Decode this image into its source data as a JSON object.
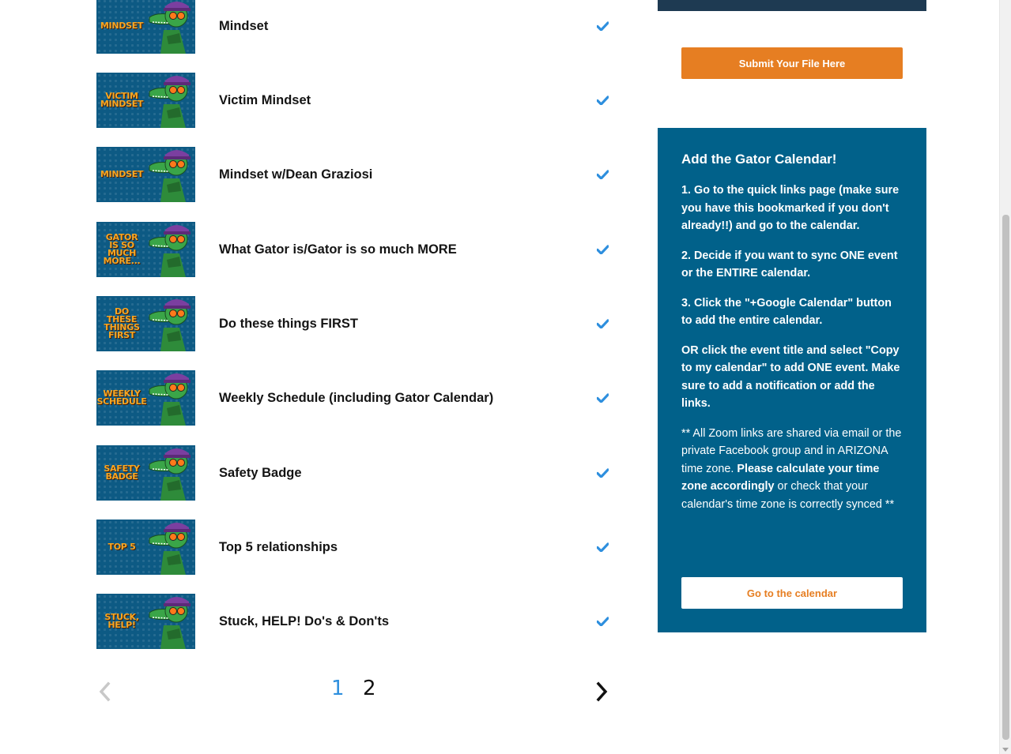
{
  "lessons": [
    {
      "title": "Mindset",
      "thumb_text": "MINDSET",
      "completed": true
    },
    {
      "title": "Victim Mindset",
      "thumb_text": "VICTIM MINDSET",
      "completed": true
    },
    {
      "title": "Mindset w/Dean Graziosi",
      "thumb_text": "MINDSET",
      "completed": true
    },
    {
      "title": "What Gator is/Gator is so much MORE",
      "thumb_text": "GATOR IS SO MUCH MORE...",
      "completed": true
    },
    {
      "title": "Do these things FIRST",
      "thumb_text": "DO THESE THINGS FIRST",
      "completed": true
    },
    {
      "title": "Weekly Schedule (including Gator Calendar)",
      "thumb_text": "WEEKLY SCHEDULE",
      "completed": true
    },
    {
      "title": "Safety Badge",
      "thumb_text": "SAFETY BADGE",
      "completed": true
    },
    {
      "title": "Top 5 relationships",
      "thumb_text": "TOP 5",
      "completed": true
    },
    {
      "title": "Stuck, HELP! Do's & Don'ts",
      "thumb_text": "STUCK, HELP!",
      "completed": true
    }
  ],
  "pagination": {
    "pages": [
      "1",
      "2"
    ],
    "current": "1"
  },
  "sidebar": {
    "submit_button": "Submit Your File Here",
    "calendar": {
      "title": "Add the Gator Calendar!",
      "step1": "1. Go to the quick links page (make sure you have this bookmarked if you don't already!!) and go to the calendar.",
      "step2": "2. Decide if you want to sync ONE event or the ENTIRE calendar.",
      "step3": "3. Click the \"+Google Calendar\" button to add the entire calendar.",
      "step4": "OR click the event title and select \"Copy to my calendar\" to add ONE event. Make sure to add a notification or add the links.",
      "note_part1": "** All Zoom links are shared via email or the private Facebook group and in ARIZONA time zone. ",
      "note_bold": "Please calculate your time zone accordingly",
      "note_part2": " or check that your calendar's time zone is correctly synced **",
      "button": "Go to the calendar"
    }
  },
  "colors": {
    "accent_orange": "#e67e22",
    "panel_blue": "#01618a",
    "check_blue": "#2e8fde",
    "thumb_blue": "#0d5a84"
  },
  "icons": {
    "check": "check-icon",
    "prev": "chevron-left-icon",
    "next": "chevron-right-icon",
    "thumb_mascot": "gator-mascot-icon"
  }
}
